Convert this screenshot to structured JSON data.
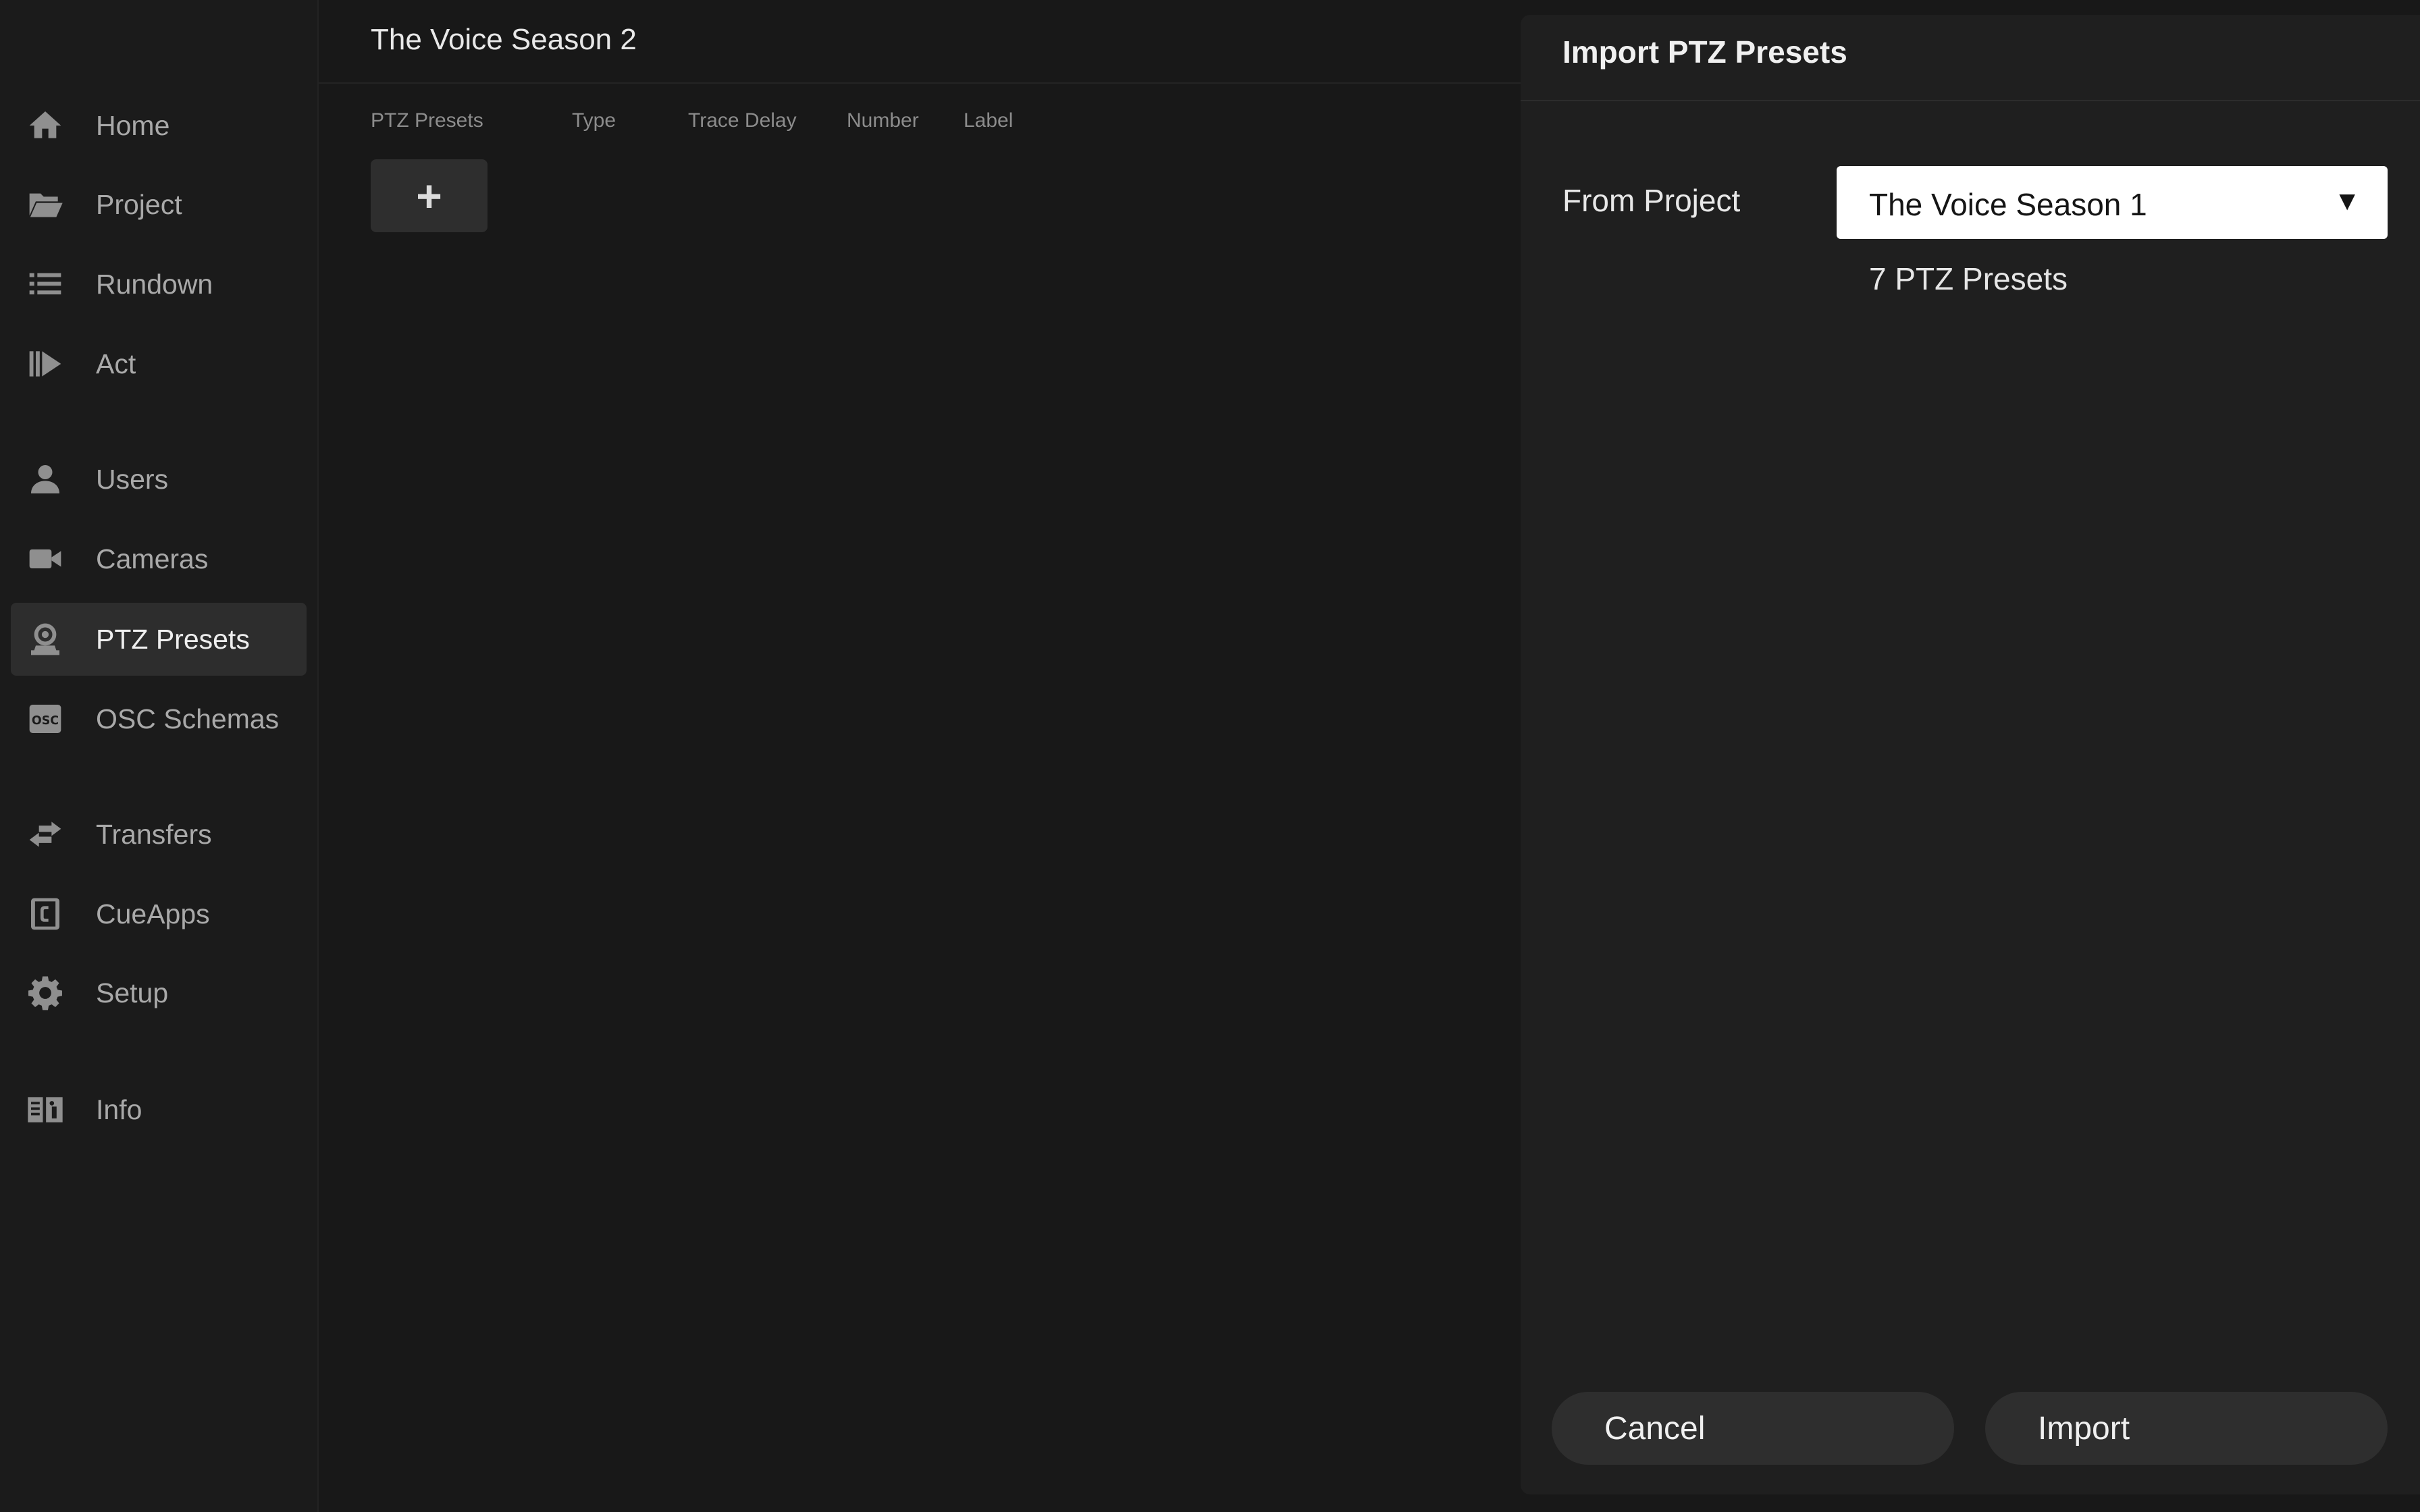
{
  "sidebar": {
    "items": [
      {
        "label": "Home",
        "icon": "home-icon",
        "active": false
      },
      {
        "label": "Project",
        "icon": "folder-open-icon",
        "active": false
      },
      {
        "label": "Rundown",
        "icon": "list-icon",
        "active": false
      },
      {
        "label": "Act",
        "icon": "play-icon",
        "active": false
      },
      {
        "label": "Users",
        "icon": "user-icon",
        "active": false
      },
      {
        "label": "Cameras",
        "icon": "video-camera-icon",
        "active": false
      },
      {
        "label": "PTZ Presets",
        "icon": "ptz-camera-icon",
        "active": true
      },
      {
        "label": "OSC Schemas",
        "icon": "osc-icon",
        "active": false
      },
      {
        "label": "Transfers",
        "icon": "transfer-arrows-icon",
        "active": false
      },
      {
        "label": "CueApps",
        "icon": "cueapps-icon",
        "active": false
      },
      {
        "label": "Setup",
        "icon": "gear-icon",
        "active": false
      },
      {
        "label": "Info",
        "icon": "book-info-icon",
        "active": false
      }
    ]
  },
  "main": {
    "project_title": "The Voice Season 2",
    "columns": [
      "PTZ Presets",
      "Type",
      "Trace Delay",
      "Number",
      "Label"
    ],
    "add_button": "+"
  },
  "dialog": {
    "title": "Import PTZ Presets",
    "from_project_label": "From Project",
    "selected_project": "The Voice Season 1",
    "select_arrow": "▼",
    "preset_count_text": "7 PTZ Presets",
    "cancel_label": "Cancel",
    "import_label": "Import"
  },
  "colors": {
    "background": "#181818",
    "sidebar": "#1b1b1b",
    "active_item": "#2d2d2d",
    "dialog": "#1f1f1f",
    "button": "#2e2e2e"
  }
}
